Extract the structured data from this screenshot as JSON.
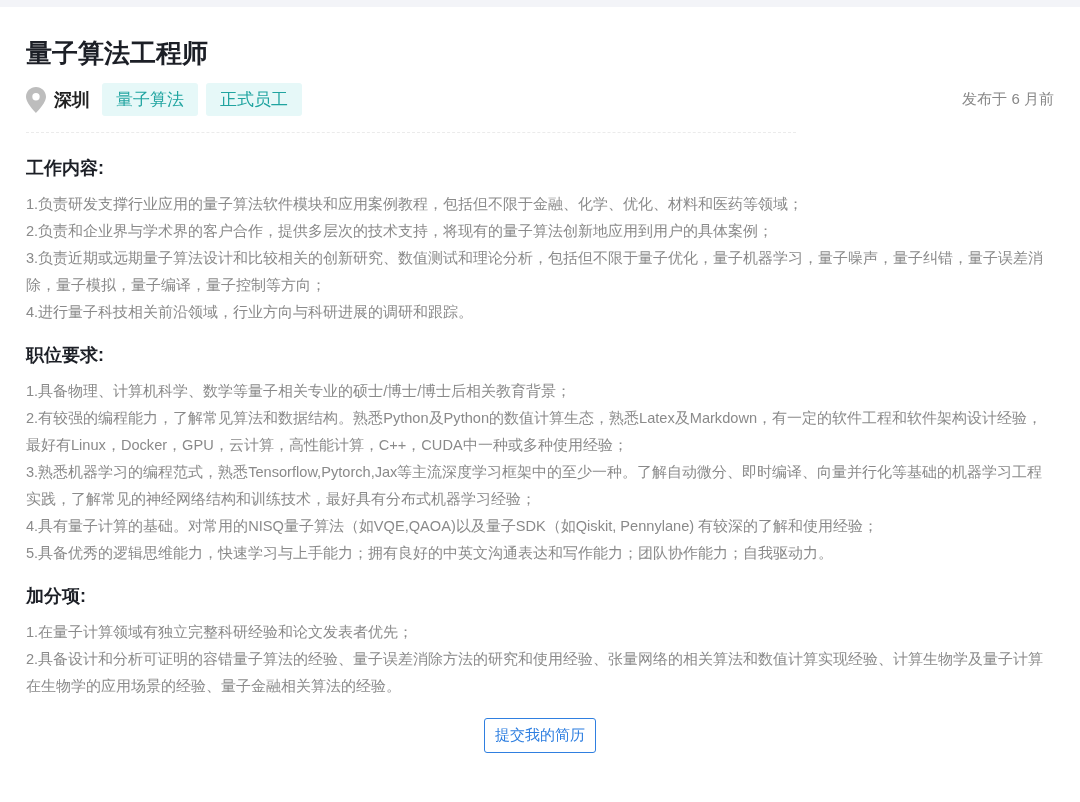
{
  "job": {
    "title": "量子算法工程师",
    "location": "深圳",
    "tags": [
      "量子算法",
      "正式员工"
    ],
    "posted": "发布于 6 月前"
  },
  "sections": [
    {
      "heading": "工作内容:",
      "items": [
        "1.负责研发支撑行业应用的量子算法软件模块和应用案例教程，包括但不限于金融、化学、优化、材料和医药等领域；",
        "2.负责和企业界与学术界的客户合作，提供多层次的技术支持，将现有的量子算法创新地应用到用户的具体案例；",
        "3.负责近期或远期量子算法设计和比较相关的创新研究、数值测试和理论分析，包括但不限于量子优化，量子机器学习，量子噪声，量子纠错，量子误差消除，量子模拟，量子编译，量子控制等方向；",
        "4.进行量子科技相关前沿领域，行业方向与科研进展的调研和跟踪。"
      ]
    },
    {
      "heading": "职位要求:",
      "items": [
        "1.具备物理、计算机科学、数学等量子相关专业的硕士/博士/博士后相关教育背景；",
        "2.有较强的编程能力，了解常见算法和数据结构。熟悉Python及Python的数值计算生态，熟悉Latex及Markdown，有一定的软件工程和软件架构设计经验，最好有Linux，Docker，GPU，云计算，高性能计算，C++，CUDA中一种或多种使用经验；",
        "3.熟悉机器学习的编程范式，熟悉Tensorflow,Pytorch,Jax等主流深度学习框架中的至少一种。了解自动微分、即时编译、向量并行化等基础的机器学习工程实践，了解常见的神经网络结构和训练技术，最好具有分布式机器学习经验；",
        "4.具有量子计算的基础。对常用的NISQ量子算法（如VQE,QAOA)以及量子SDK（如Qiskit, Pennylane) 有较深的了解和使用经验；",
        "5.具备优秀的逻辑思维能力，快速学习与上手能力；拥有良好的中英文沟通表达和写作能力；团队协作能力；自我驱动力。"
      ]
    },
    {
      "heading": "加分项:",
      "items": [
        "1.在量子计算领域有独立完整科研经验和论文发表者优先；",
        "2.具备设计和分析可证明的容错量子算法的经验、量子误差消除方法的研究和使用经验、张量网络的相关算法和数值计算实现经验、计算生物学及量子计算在生物学的应用场景的经验、量子金融相关算法的经验。"
      ]
    }
  ],
  "submit_button": "提交我的简历"
}
